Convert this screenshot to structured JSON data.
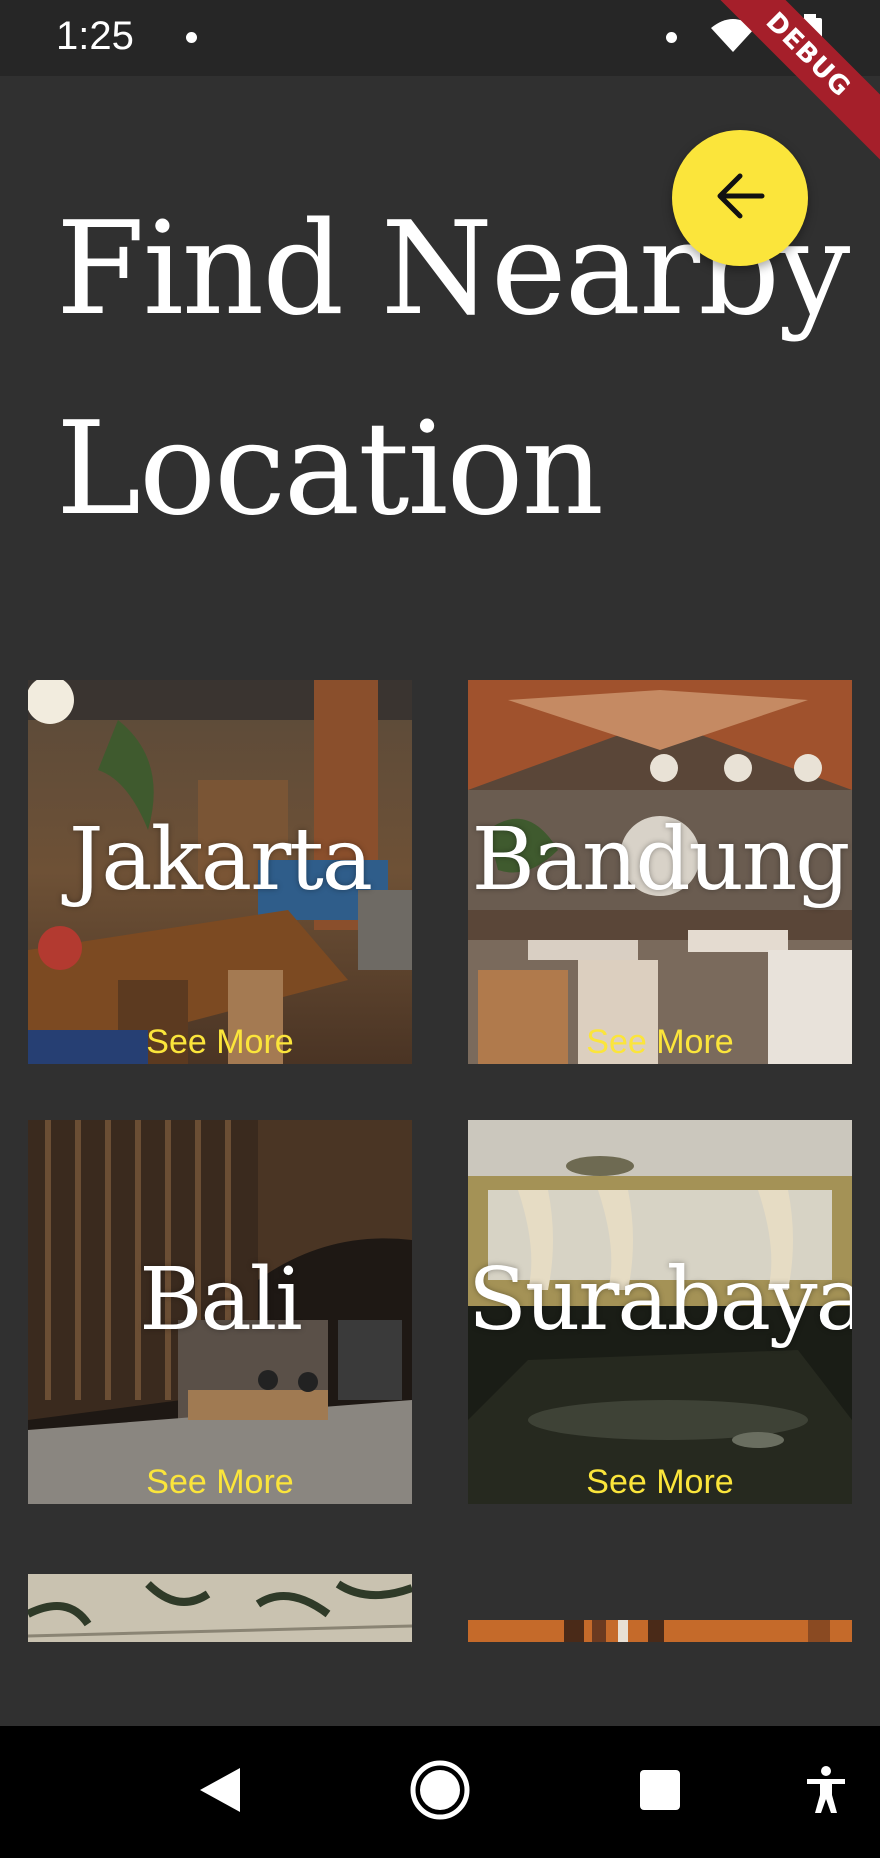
{
  "status_bar": {
    "time": "1:25",
    "debug_label": "DEBUG"
  },
  "page": {
    "title_line1": "Find Nearby",
    "title_line2": "Location",
    "back_icon": "arrow-left-icon",
    "accent_color": "#fbe53b",
    "background_color": "#303030"
  },
  "cities": [
    {
      "name": "Jakarta",
      "action": "See More"
    },
    {
      "name": "Bandung",
      "action": "See More"
    },
    {
      "name": "Bali",
      "action": "See More"
    },
    {
      "name": "Surabaya",
      "action": "See More"
    }
  ],
  "nav_bar": {
    "back_icon": "triangle-back-icon",
    "home_icon": "circle-home-icon",
    "recents_icon": "square-recents-icon",
    "accessibility_icon": "accessibility-icon"
  }
}
